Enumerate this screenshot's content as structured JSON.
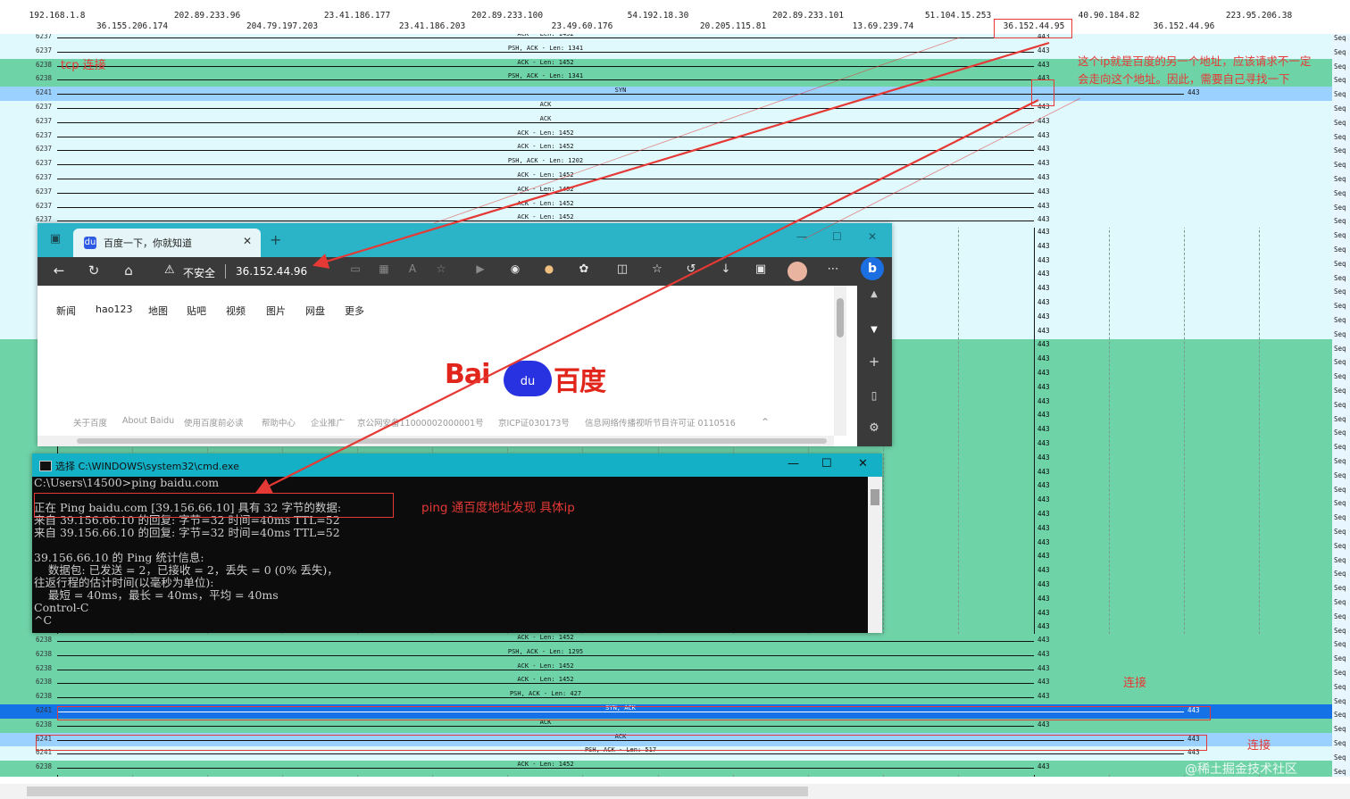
{
  "flow": {
    "hosts_top": [
      "192.168.1.8",
      "202.89.233.96",
      "23.41.186.177",
      "202.89.233.100",
      "54.192.18.30",
      "202.89.233.101",
      "51.104.15.253",
      "40.90.184.82",
      "223.95.206.38"
    ],
    "hosts_bottom": [
      "36.155.206.174",
      "204.79.197.203",
      "23.41.186.203",
      "23.49.60.176",
      "20.205.115.81",
      "13.69.239.74",
      "36.152.44.95",
      "36.152.44.96"
    ],
    "rows_top": [
      {
        "port": "6237",
        "label": "ACK - Len: 1452",
        "dst": "443",
        "style": "light"
      },
      {
        "port": "6237",
        "label": "PSH, ACK - Len: 1341",
        "dst": "443",
        "style": "light"
      },
      {
        "port": "6238",
        "label": "ACK - Len: 1452",
        "dst": "443",
        "style": "green"
      },
      {
        "port": "6238",
        "label": "PSH, ACK - Len: 1341",
        "dst": "443",
        "style": "green"
      },
      {
        "port": "6241",
        "label": "SYN",
        "dst": "443",
        "style": "blue"
      },
      {
        "port": "6237",
        "label": "ACK",
        "dst": "443",
        "style": "light"
      },
      {
        "port": "6237",
        "label": "ACK",
        "dst": "443",
        "style": "light"
      },
      {
        "port": "6237",
        "label": "ACK - Len: 1452",
        "dst": "443",
        "style": "light"
      },
      {
        "port": "6237",
        "label": "ACK - Len: 1452",
        "dst": "443",
        "style": "light"
      },
      {
        "port": "6237",
        "label": "PSH, ACK - Len: 1202",
        "dst": "443",
        "style": "light"
      },
      {
        "port": "6237",
        "label": "ACK - Len: 1452",
        "dst": "443",
        "style": "light"
      },
      {
        "port": "6237",
        "label": "ACK - Len: 1452",
        "dst": "443",
        "style": "light"
      },
      {
        "port": "6237",
        "label": "ACK - Len: 1452",
        "dst": "443",
        "style": "light"
      },
      {
        "port": "6237",
        "label": "ACK - Len: 1452",
        "dst": "443",
        "style": "light"
      }
    ],
    "rows_bottom": [
      {
        "port": "6238",
        "label": "ACK - Len: 1452",
        "dst": "443",
        "style": "green"
      },
      {
        "port": "6238",
        "label": "PSH, ACK - Len: 1295",
        "dst": "443",
        "style": "green"
      },
      {
        "port": "6238",
        "label": "ACK - Len: 1452",
        "dst": "443",
        "style": "green"
      },
      {
        "port": "6238",
        "label": "ACK - Len: 1452",
        "dst": "443",
        "style": "green"
      },
      {
        "port": "6238",
        "label": "PSH, ACK - Len: 427",
        "dst": "443",
        "style": "green"
      },
      {
        "port": "6241",
        "label": "SYN, ACK",
        "dst": "443",
        "style": "dark"
      },
      {
        "port": "6238",
        "label": "ACK",
        "dst": "443",
        "style": "green"
      },
      {
        "port": "6241",
        "label": "ACK",
        "dst": "443",
        "style": "blue"
      },
      {
        "port": "6241",
        "label": "PSH, ACK - Len: 517",
        "dst": "443",
        "style": "light"
      },
      {
        "port": "6238",
        "label": "ACK - Len: 1452",
        "dst": "443",
        "style": "green"
      }
    ],
    "side_port": "443",
    "seq_label": "Seq",
    "colors": {
      "light": "#e0f9fd",
      "green": "#6fd3a8",
      "blue": "#9bd1ff",
      "dark": "#1572e6",
      "annotation": "#e53935"
    }
  },
  "annotations": {
    "tcp": "tcp 连接",
    "note_line1": "这个ip就是百度的另一个地址，应该请求不一定",
    "note_line2": "会走向这个地址。因此，需要自己寻找一下",
    "ping": "ping 通百度地址发现 具体ip",
    "connect1": "连接",
    "connect2": "连接",
    "watermark": "@稀土掘金技术社区"
  },
  "browser": {
    "tab_title": "百度一下，你就知道",
    "tab_favicon": "du",
    "new_tab": "+",
    "insecure_label": "不安全",
    "url": "36.152.44.96",
    "nav": [
      "新闻",
      "hao123",
      "地图",
      "贴吧",
      "视频",
      "图片",
      "网盘",
      "更多"
    ],
    "logo_text_left": "Bai",
    "logo_paw": "du",
    "logo_text_right": "百度",
    "footer": [
      "关于百度",
      "About Baidu",
      "使用百度前必读",
      "帮助中心",
      "企业推广",
      "京公网安备11000002000001号",
      "京ICP证030173号",
      "信息网络传播视听节目许可证 0110516"
    ],
    "sidebar_bing": "b"
  },
  "cmd": {
    "title": "选择 C:\\WINDOWS\\system32\\cmd.exe",
    "lines": [
      "C:\\Users\\14500>ping baidu.com",
      "",
      "正在 Ping baidu.com [39.156.66.10] 具有 32 字节的数据:",
      "来自 39.156.66.10 的回复: 字节=32 时间=40ms TTL=52",
      "来自 39.156.66.10 的回复: 字节=32 时间=40ms TTL=52",
      "",
      "39.156.66.10 的 Ping 统计信息:",
      "    数据包: 已发送 = 2，已接收 = 2，丢失 = 0 (0% 丢失)，",
      "往返行程的估计时间(以毫秒为单位):",
      "    最短 = 40ms，最长 = 40ms，平均 = 40ms",
      "Control-C",
      "^C"
    ]
  }
}
